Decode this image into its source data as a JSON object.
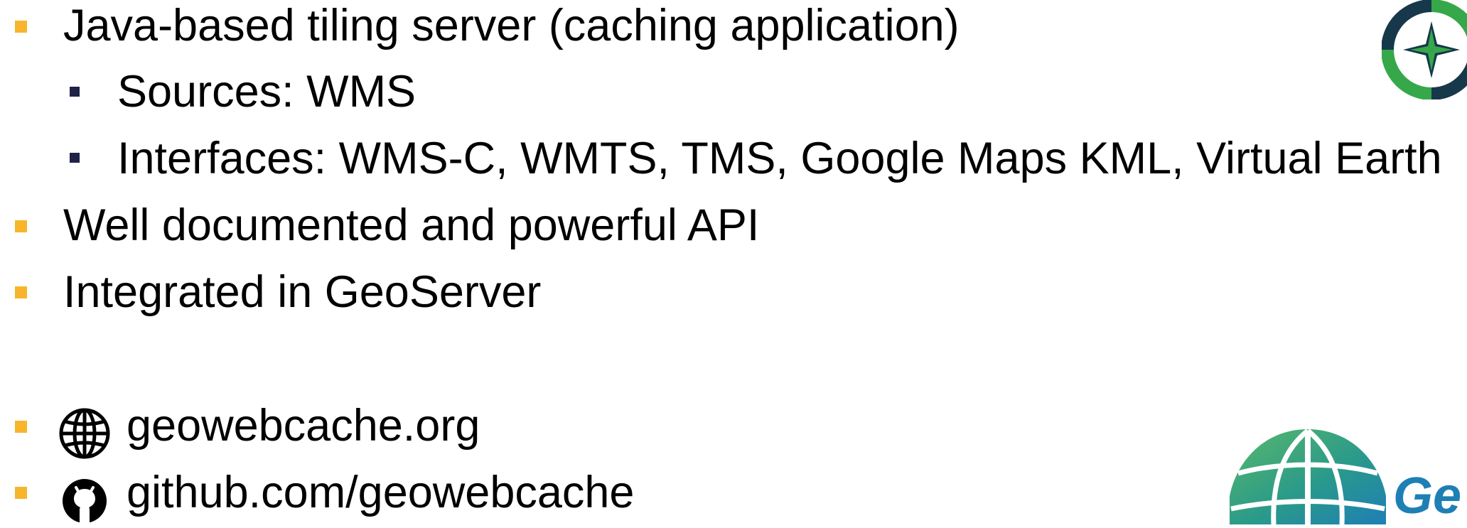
{
  "bullets": {
    "item1": "Java-based tiling server (caching application)",
    "item1_sub1": "Sources: WMS",
    "item1_sub2": "Interfaces: WMS-C, WMTS, TMS, Google Maps KML, Virtual Earth",
    "item2": "Well documented and powerful API",
    "item3": "Integrated in GeoServer"
  },
  "links": {
    "website": "geowebcache.org",
    "github": "github.com/geowebcache"
  },
  "icons": {
    "website": "globe-icon",
    "github": "github-icon",
    "top_logo": "compass-logo",
    "bottom_logo": "geowebcache-globe-logo"
  },
  "logos": {
    "bottom_logo_text": "Ge"
  },
  "colors": {
    "level1_bullet": "#f7b52c",
    "level2_bullet": "#1f2346",
    "logo_green": "#36a84a",
    "logo_dark": "#16384a",
    "logo_blue": "#1e7fb5"
  }
}
